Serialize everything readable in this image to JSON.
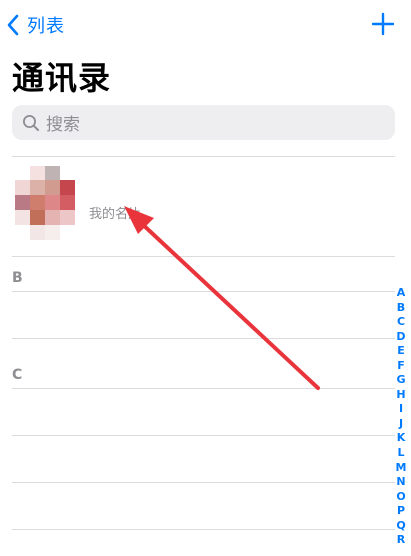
{
  "nav": {
    "back_label": "列表",
    "back_icon": "chevron-left-icon",
    "add_icon": "plus-icon",
    "accent": "#007aff"
  },
  "title": "通讯录",
  "search": {
    "placeholder": "搜索",
    "icon": "magnifier-icon"
  },
  "my_card": {
    "label": "我的名片"
  },
  "sections": [
    "B",
    "C"
  ],
  "index_letters": [
    "A",
    "B",
    "C",
    "D",
    "E",
    "F",
    "G",
    "H",
    "I",
    "J",
    "K",
    "L",
    "M",
    "N",
    "O",
    "P",
    "Q",
    "R"
  ],
  "annotation": {
    "arrow_color": "#e8343a"
  }
}
